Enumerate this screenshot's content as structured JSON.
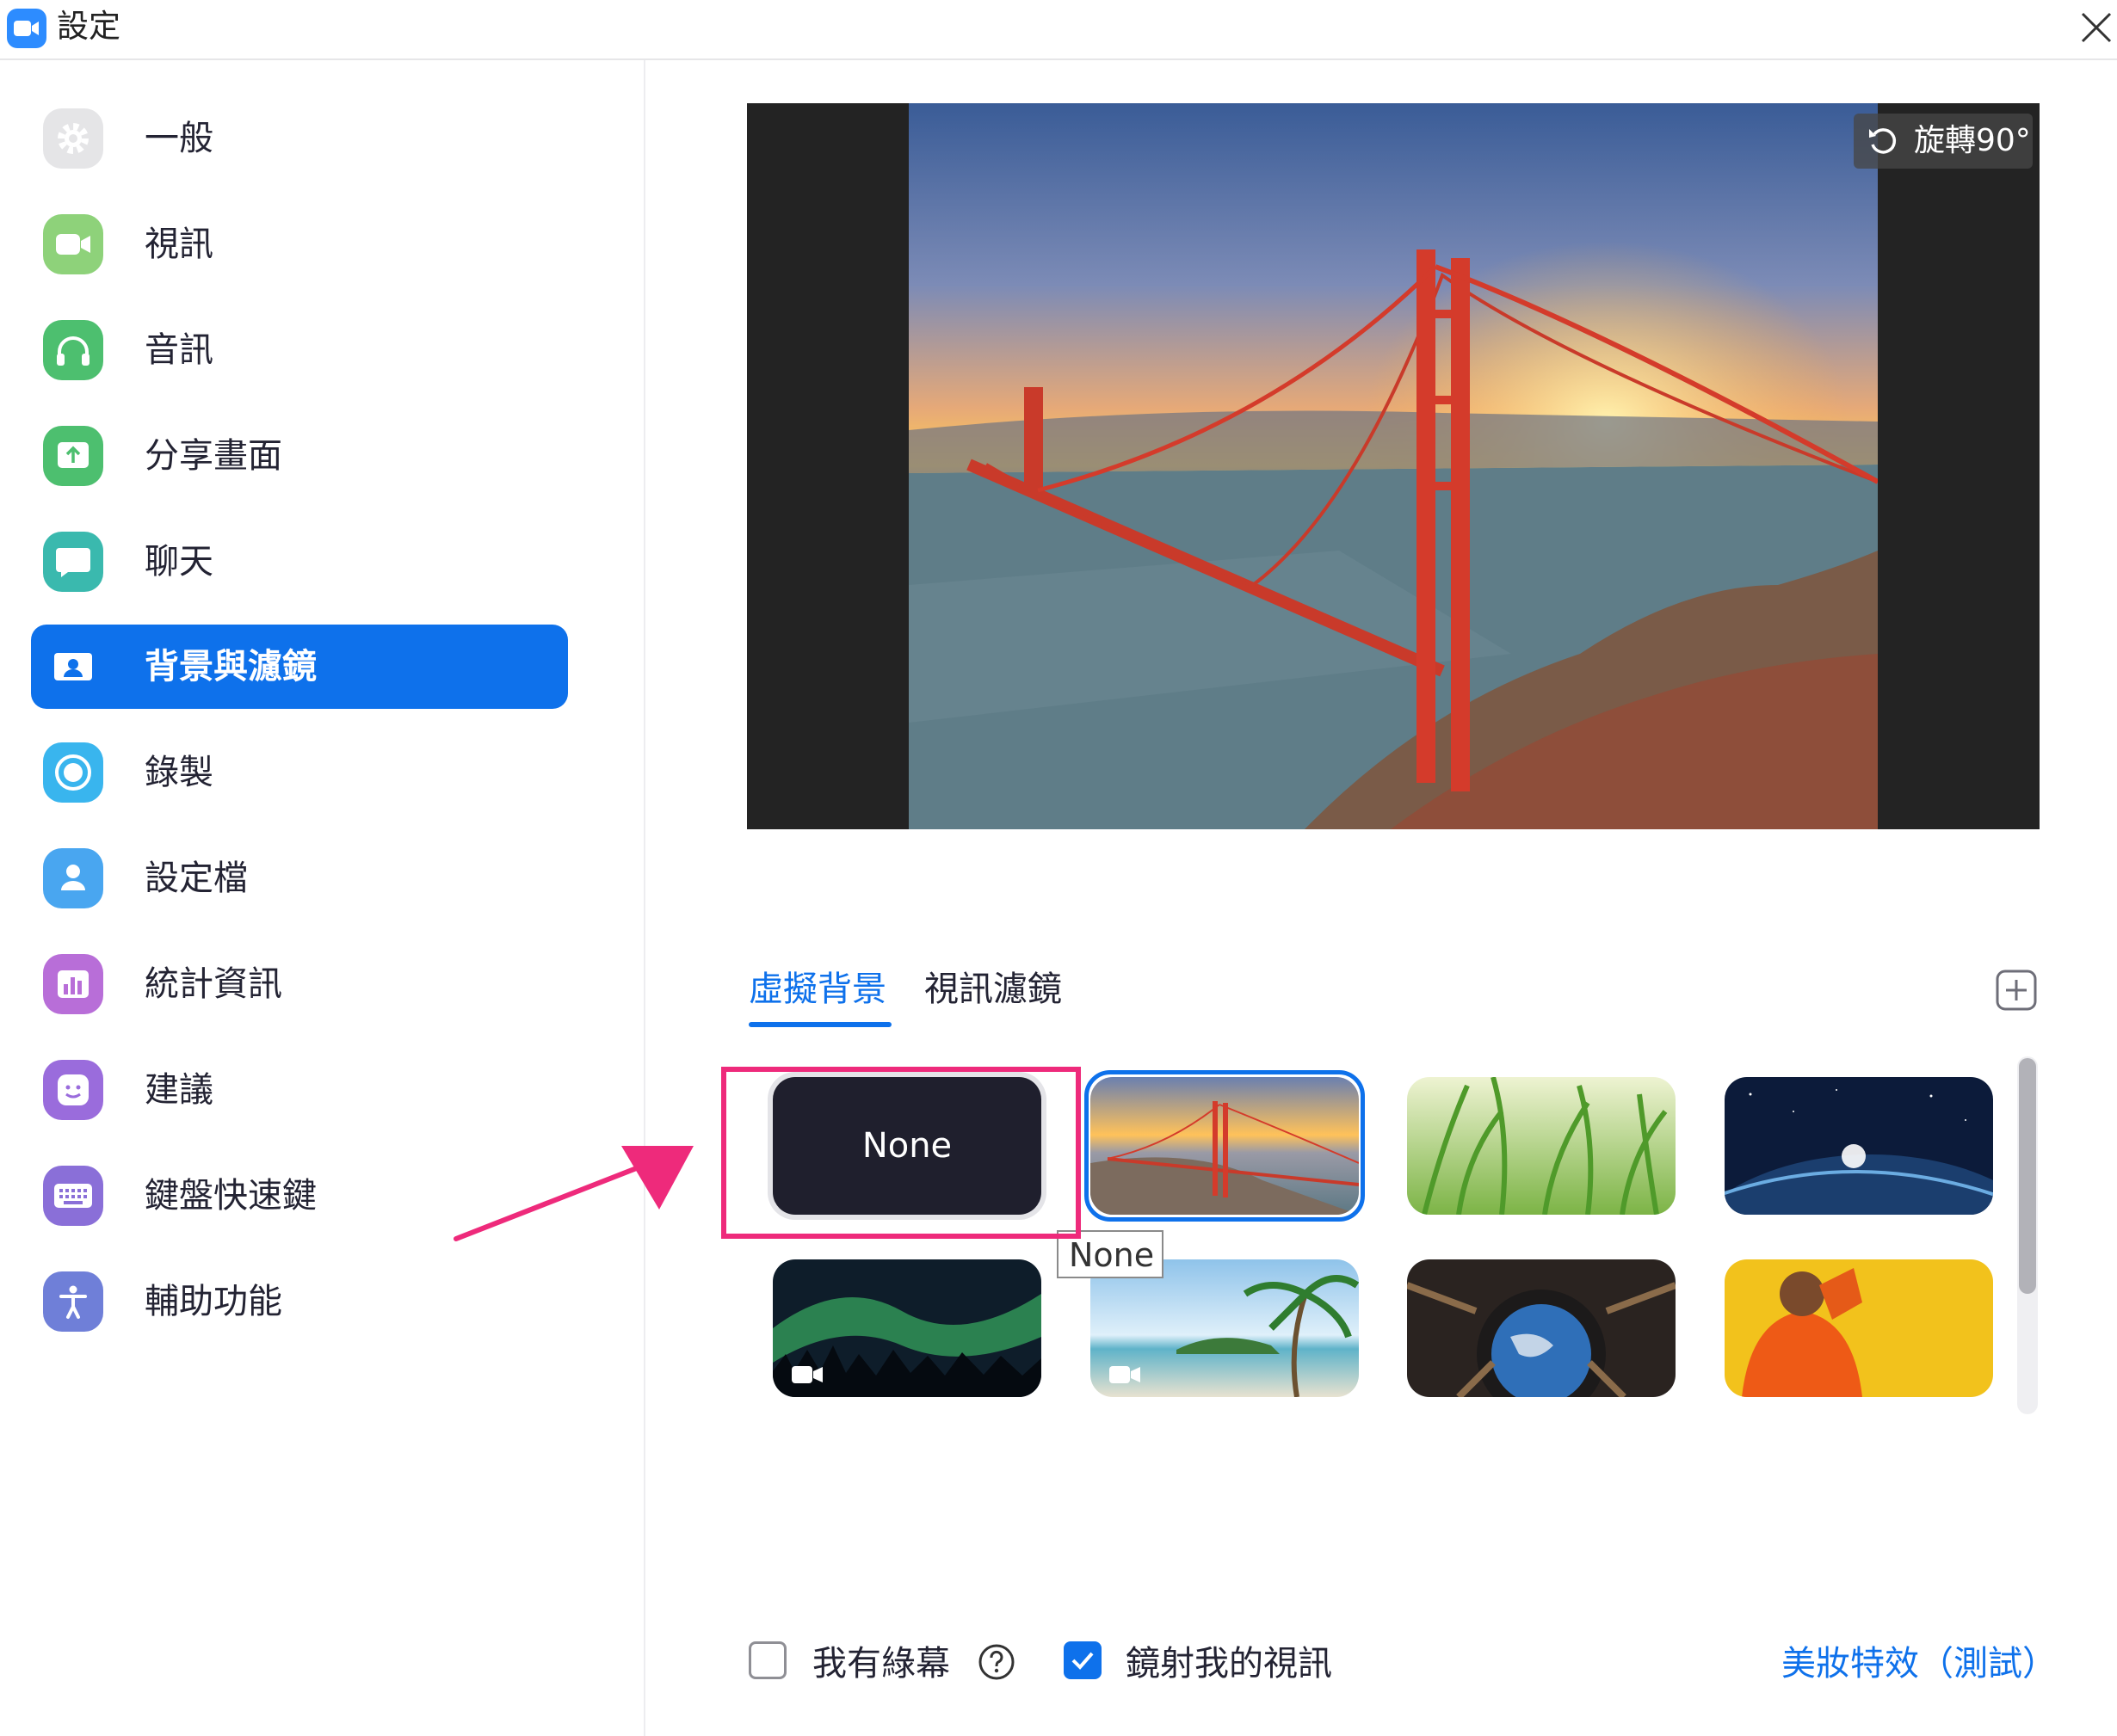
{
  "window": {
    "title": "設定"
  },
  "sidebar": {
    "items": [
      {
        "label": "一般",
        "icon": "gear-icon",
        "color": "#e5e5e7"
      },
      {
        "label": "視訊",
        "icon": "video-camera-icon",
        "color": "#8ed27a"
      },
      {
        "label": "音訊",
        "icon": "headphones-icon",
        "color": "#4dbf6f"
      },
      {
        "label": "分享畫面",
        "icon": "share-screen-icon",
        "color": "#4dbf6f"
      },
      {
        "label": "聊天",
        "icon": "chat-bubble-icon",
        "color": "#3ab9ae"
      },
      {
        "label": "背景與濾鏡",
        "icon": "background-person-icon",
        "color": "#0e71eb",
        "active": true
      },
      {
        "label": "錄製",
        "icon": "record-icon",
        "color": "#39b5ee"
      },
      {
        "label": "設定檔",
        "icon": "profile-icon",
        "color": "#49a6f0"
      },
      {
        "label": "統計資訊",
        "icon": "statistics-icon",
        "color": "#b86ed8"
      },
      {
        "label": "建議",
        "icon": "feedback-smiley-icon",
        "color": "#9a6cdc"
      },
      {
        "label": "鍵盤快速鍵",
        "icon": "keyboard-icon",
        "color": "#8a6fd8"
      },
      {
        "label": "輔助功能",
        "icon": "accessibility-icon",
        "color": "#6f7fd8"
      }
    ]
  },
  "preview": {
    "rotate_label": "旋轉90°"
  },
  "tabs": [
    {
      "label": "虛擬背景",
      "active": true
    },
    {
      "label": "視訊濾鏡",
      "active": false
    }
  ],
  "backgrounds": {
    "none_label": "None",
    "tooltip": "None",
    "items": [
      "none",
      "golden-gate-bridge",
      "green-grass",
      "earth-from-space",
      "aurora-video",
      "beach-palm-video",
      "space-station-window",
      "orange-jacket-person"
    ],
    "selected": "golden-gate-bridge"
  },
  "bottom": {
    "green_screen_label": "我有綠幕",
    "green_screen_checked": false,
    "mirror_label": "鏡射我的視訊",
    "mirror_checked": true,
    "beauty_link": "美妝特效（測試）"
  },
  "colors": {
    "accent": "#0e71eb",
    "annotation": "#ee2a7b"
  }
}
